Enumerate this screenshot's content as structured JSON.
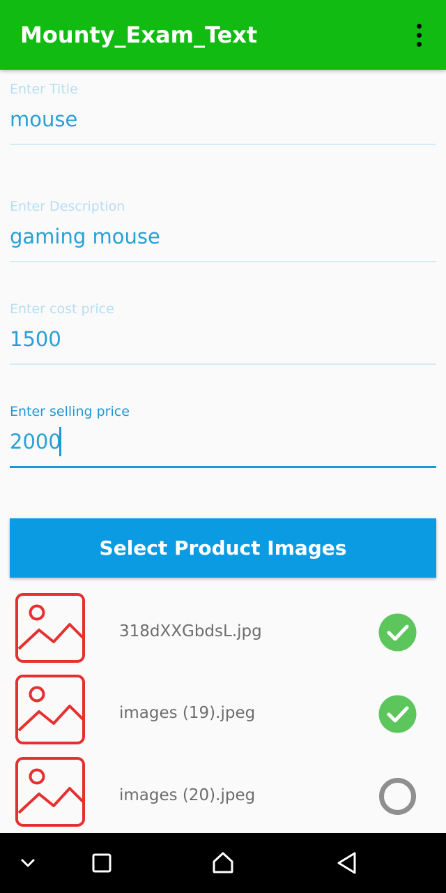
{
  "app_bar": {
    "title": "Mounty_Exam_Text",
    "overflow_icon": "more-vert-icon",
    "background_color": "#12bb12"
  },
  "form": {
    "title_field": {
      "label": "Enter Title",
      "value": "mouse"
    },
    "description_field": {
      "label": "Enter Description",
      "value": "gaming mouse"
    },
    "cost_price_field": {
      "label": "Enter cost price",
      "value": "1500"
    },
    "selling_price_field": {
      "label": "Enter selling price",
      "value": "2000",
      "focused": true
    }
  },
  "select_images_button": {
    "label": "Select Product Images",
    "background_color": "#0a9be3"
  },
  "images": [
    {
      "filename": "318dXXGbdsL.jpg",
      "icon": "image-placeholder-icon",
      "status": "uploaded",
      "status_icon": "check-circle-icon"
    },
    {
      "filename": "images (19).jpeg",
      "icon": "image-placeholder-icon",
      "status": "uploaded",
      "status_icon": "check-circle-icon"
    },
    {
      "filename": "images (20).jpeg",
      "icon": "image-placeholder-icon",
      "status": "pending",
      "status_icon": "progress-ring-icon"
    }
  ],
  "nav_bar": {
    "buttons": [
      "chevron-down-icon",
      "recents-square-icon",
      "home-icon",
      "back-triangle-icon"
    ]
  },
  "colors": {
    "accent": "#1f97d4",
    "success": "#5cc55c",
    "pending": "#8f8f8f",
    "thumbnail": "#e53030"
  }
}
